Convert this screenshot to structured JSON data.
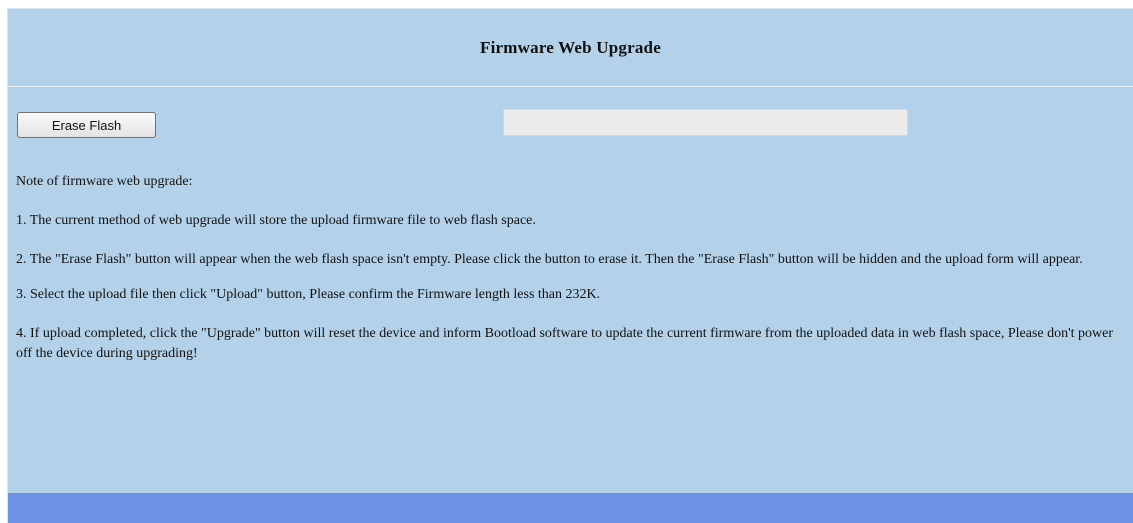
{
  "header": {
    "title": "Firmware Web Upgrade"
  },
  "controls": {
    "erase_button_label": "Erase Flash",
    "progress_fraction": 0
  },
  "notes": {
    "intro": "Note of firmware web upgrade:",
    "items": [
      "1. The current method of web upgrade will store the upload firmware file to web flash space.",
      "2. The \"Erase Flash\" button will appear when the web flash space isn't empty. Please click the button to erase it. Then the \"Erase Flash\" button will be hidden and the upload form will appear.",
      "3. Select the upload file then click \"Upload\" button, Please confirm the Firmware length less than 232K.",
      "4. If upload completed, click the \"Upgrade\" button will reset the device and inform Bootload software to update the current firmware from the uploaded data in web flash space, Please don't power off the device during upgrading!"
    ]
  },
  "colors": {
    "page_background": "#b3d2ea",
    "footer_bar": "#6b92e3",
    "progress_track": "#ebebeb"
  }
}
